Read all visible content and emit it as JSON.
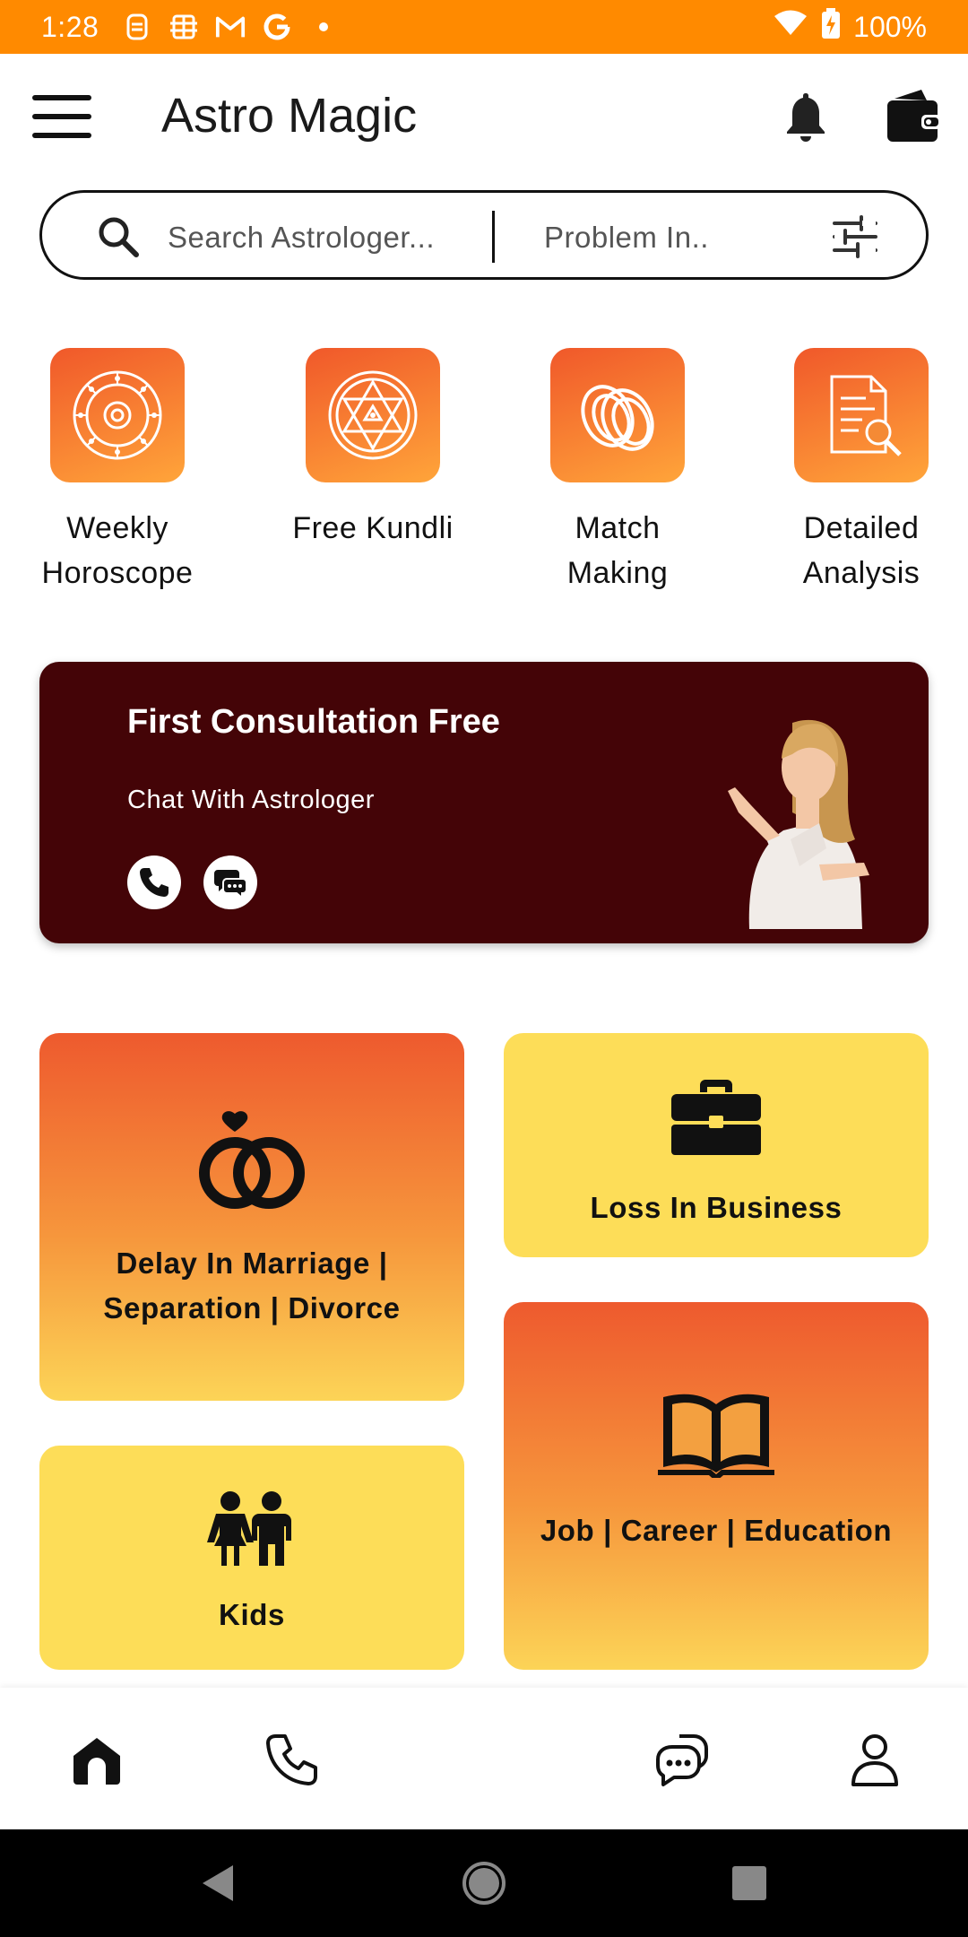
{
  "status_bar": {
    "time": "1:28",
    "notification_icons": [
      "sim-card-icon",
      "cast-icon",
      "gmail-icon",
      "google-icon",
      "dot-icon"
    ],
    "battery_text": "100%"
  },
  "header": {
    "title": "Astro Magic"
  },
  "search": {
    "astrologer_placeholder": "Search Astrologer...",
    "problem_placeholder": "Problem In.."
  },
  "quick_services": [
    {
      "label": "Weekly Horoscope",
      "icon": "zodiac-wheel-icon"
    },
    {
      "label": "Free Kundli",
      "icon": "star-of-david-icon"
    },
    {
      "label": "Match Making",
      "icon": "rings-icon"
    },
    {
      "label": "Detailed Analysis",
      "icon": "document-search-icon"
    }
  ],
  "promo": {
    "title": "First Consultation Free",
    "subtitle": "Chat With Astrologer",
    "background": "#440407"
  },
  "problem_cards": [
    {
      "label": "Delay In Marriage | Separation | Divorce",
      "icon": "wedding-rings-icon",
      "style": "orange"
    },
    {
      "label": "Loss In Business",
      "icon": "briefcase-icon",
      "style": "yellow"
    },
    {
      "label": "Kids",
      "icon": "children-icon",
      "style": "yellow"
    },
    {
      "label": "Job | Career | Education",
      "icon": "open-book-icon",
      "style": "orange"
    }
  ],
  "bottom_nav": {
    "items": [
      "home-icon",
      "phone-icon",
      "chat-icon",
      "profile-icon"
    ],
    "active": "home-icon"
  },
  "colors": {
    "status_bar": "#FF8A00",
    "accent_orange": "#F0582A",
    "accent_yellow": "#FDDD58",
    "promo_bg": "#440407"
  }
}
